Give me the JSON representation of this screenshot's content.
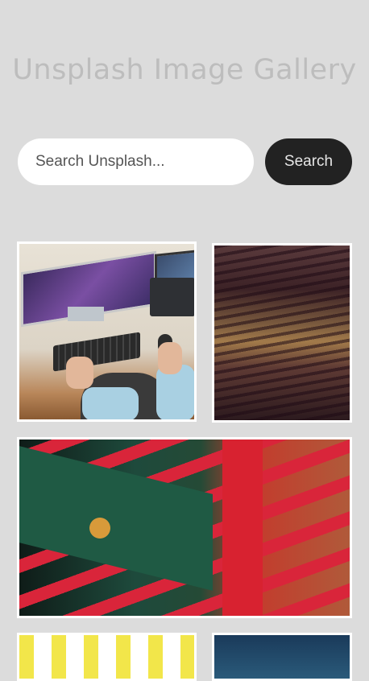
{
  "header": {
    "title": "Unsplash Image Gallery"
  },
  "search": {
    "placeholder": "Search Unsplash...",
    "value": "",
    "button_label": "Search"
  },
  "gallery": {
    "images": [
      {
        "name": "desk-workspace-image",
        "icon": "photo"
      },
      {
        "name": "abstract-texture-image",
        "icon": "photo"
      },
      {
        "name": "street-flags-image",
        "icon": "photo"
      },
      {
        "name": "yellow-image",
        "icon": "photo"
      },
      {
        "name": "blue-image",
        "icon": "photo"
      }
    ]
  }
}
